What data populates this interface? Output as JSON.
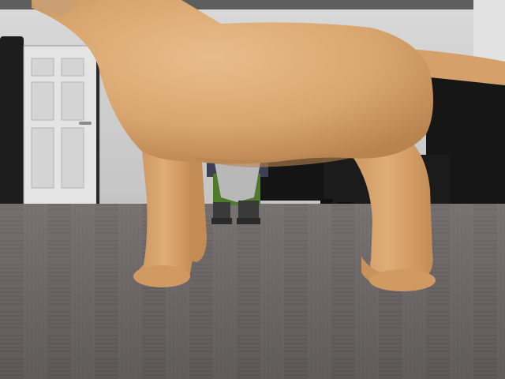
{
  "scene": {
    "description_visible_text": "",
    "colors": {
      "ceiling": "#5a5a5a",
      "wall": "#cfcfcf",
      "wall_shadow": "#b9b9b9",
      "door": "#e3e3e3",
      "door_panel": "#d2d2d2",
      "floor_dark": "#4a4545",
      "floor_light": "#8c8585",
      "dog_fur": "#d9a56e",
      "dog_fur_light": "#e8bd8b",
      "dog_fur_dark": "#b8834f",
      "furniture": "#151515",
      "gnome_shirt": "#4f7a2a",
      "gnome_beard": "#b8b8b8"
    },
    "objects": [
      "door",
      "dog",
      "garden-gnome",
      "black-sofa",
      "black-cabinet",
      "parquet-floor"
    ]
  }
}
